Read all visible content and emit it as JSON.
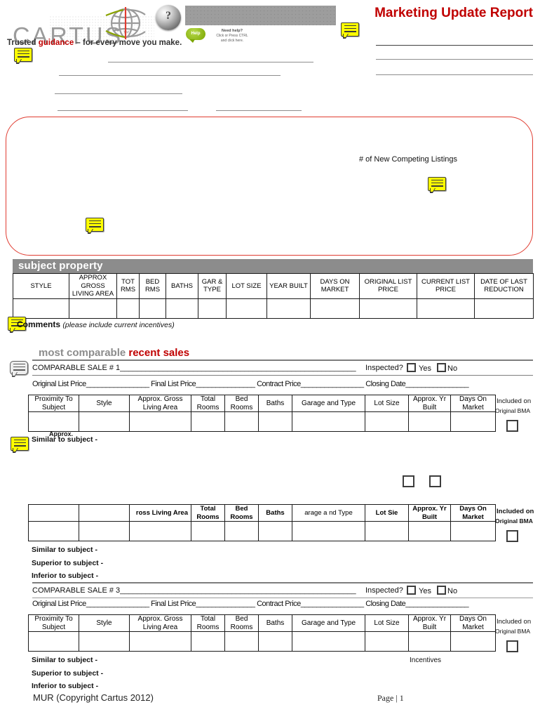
{
  "document": {
    "title": "Marketing Update Report",
    "brand_name": "CARTUS",
    "brand_tm": "™",
    "tagline_pre": "Trusted ",
    "tagline_accent": "guidance",
    "tagline_post": " – for every move you make.",
    "footer_left": "MUR (Copyright Cartus 2012)",
    "footer_right": "Page | 1"
  },
  "help": {
    "badge_label": "Help",
    "line1": "Need help?",
    "line2": "Click or Press CTRL",
    "line3": "and click here."
  },
  "market_box": {
    "new_competing_listings_label": "# of  New Competing Listings"
  },
  "subject_property": {
    "band_label": "subject property",
    "columns": [
      "STYLE",
      "APPROX GROSS LIVING AREA",
      "TOT RMS",
      "BED RMS",
      "BATHS",
      "GAR & TYPE",
      "LOT SIZE",
      "YEAR BUILT",
      "DAYS ON MARKET",
      "ORIGINAL LIST PRICE",
      "CURRENT LIST PRICE",
      "DATE OF LAST REDUCTION"
    ],
    "values": [
      "",
      "",
      "",
      "",
      "",
      "",
      "",
      "",
      "",
      "",
      "",
      ""
    ],
    "comments_label": "Comments",
    "comments_hint": "(please include current incentives)"
  },
  "recent_sales": {
    "title_gray": "most comparable ",
    "title_red": "recent sales",
    "inspected_label": "Inspected?",
    "yes_label": "Yes",
    "no_label": "No",
    "price_line": "Original List Price________________    Final List Price_______________      Contract Price________________      Closing Date________________",
    "included_line1": "Included on",
    "included_line2": "Original BMA",
    "similar_label": "Similar to subject -",
    "superior_label": "Superior to subject -",
    "inferior_label": "Inferior to subject -",
    "approx_label": "Approx.",
    "incentives_label": "Incentives",
    "comparable_columns": [
      "Proximity To Subject",
      "Style",
      "Approx. Gross Living Area",
      "Total Rooms",
      "Bed Rooms",
      "Baths",
      "Garage and Type",
      "Lot Size",
      "Approx. Yr Built",
      "Days On Market"
    ],
    "truncated_columns": [
      "",
      "",
      "ross Living Area",
      "Total Rooms",
      "Bed Rooms",
      "Baths",
      "arage a  nd Type",
      "Lot Sie",
      "Approx. Yr Built",
      "Days On Market"
    ],
    "sales": [
      {
        "heading": "COMPARABLE SALE # 1"
      },
      {
        "heading": ""
      },
      {
        "heading": "COMPARABLE SALE # 3"
      }
    ]
  },
  "colors": {
    "brand_red": "#c00000",
    "brand_gray": "#9b9b9b",
    "band_gray": "#8c8c8c",
    "box_red": "#e03c31",
    "note_yellow": "#ffff00"
  }
}
